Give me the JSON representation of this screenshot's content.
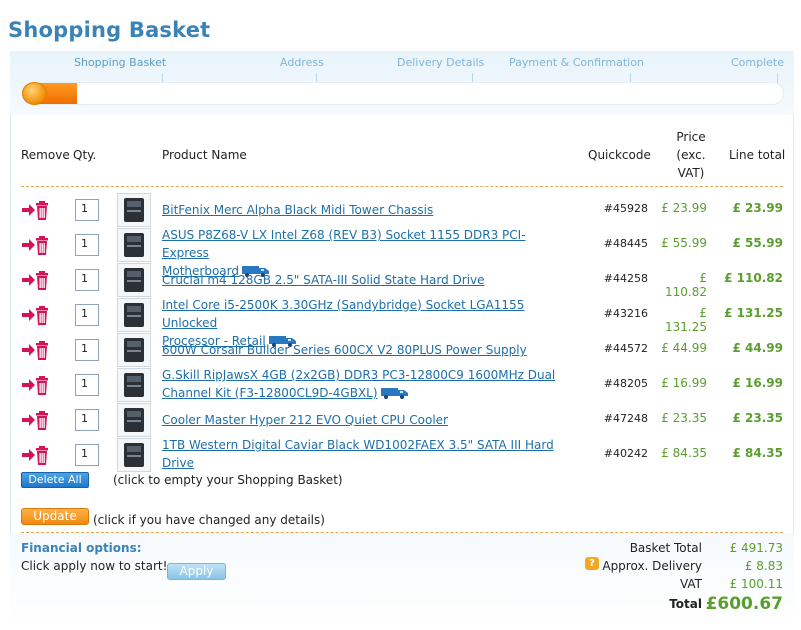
{
  "page": {
    "title": "Shopping Basket"
  },
  "steps": [
    {
      "label": "Shopping Basket"
    },
    {
      "label": "Address"
    },
    {
      "label": "Delivery Details"
    },
    {
      "label": "Payment & Confirmation"
    },
    {
      "label": "Complete"
    }
  ],
  "progress": {
    "current_step": 1,
    "total_steps": 5
  },
  "table": {
    "headers": {
      "remove": "Remove",
      "qty": "Qty.",
      "product": "Product Name",
      "quickcode": "Quickcode",
      "price_line1": "Price",
      "price_line2": "(exc.",
      "price_line3": "VAT)",
      "line_total": "Line total"
    },
    "rows": [
      {
        "qty": "1",
        "name": "BitFenix Merc Alpha Black Midi Tower Chassis",
        "name2": "",
        "truck": false,
        "quickcode": "#45928",
        "price": "£ 23.99",
        "total": "£ 23.99"
      },
      {
        "qty": "1",
        "name": "ASUS P8Z68-V LX Intel Z68 (REV B3) Socket 1155 DDR3 PCI-Express",
        "name2": "Motherboard",
        "truck": true,
        "quickcode": "#48445",
        "price": "£ 55.99",
        "total": "£ 55.99"
      },
      {
        "qty": "1",
        "name": "Crucial m4 128GB 2.5\" SATA-III Solid State Hard Drive",
        "name2": "",
        "truck": false,
        "quickcode": "#44258",
        "price": "£ 110.82",
        "total": "£ 110.82"
      },
      {
        "qty": "1",
        "name": "Intel Core i5-2500K 3.30GHz (Sandybridge) Socket LGA1155 Unlocked",
        "name2": "Processor - Retail",
        "truck": true,
        "quickcode": "#43216",
        "price": "£ 131.25",
        "total": "£ 131.25"
      },
      {
        "qty": "1",
        "name": "600W Corsair Builder Series 600CX V2 80PLUS Power Supply",
        "name2": "",
        "truck": false,
        "quickcode": "#44572",
        "price": "£ 44.99",
        "total": "£ 44.99"
      },
      {
        "qty": "1",
        "name": "G.Skill RipJawsX 4GB (2x2GB) DDR3 PC3-12800C9 1600MHz Dual",
        "name2": "Channel Kit (F3-12800CL9D-4GBXL)",
        "truck": true,
        "quickcode": "#48205",
        "price": "£ 16.99",
        "total": "£ 16.99"
      },
      {
        "qty": "1",
        "name": "Cooler Master Hyper 212 EVO Quiet CPU Cooler",
        "name2": "",
        "truck": false,
        "quickcode": "#47248",
        "price": "£ 23.35",
        "total": "£ 23.35"
      },
      {
        "qty": "1",
        "name": "1TB Western Digital Caviar Black WD1002FAEX 3.5\" SATA III Hard",
        "name2": "Drive",
        "truck": false,
        "quickcode": "#40242",
        "price": "£ 84.35",
        "total": "£ 84.35"
      }
    ]
  },
  "actions": {
    "delete_all": "Delete All",
    "delete_all_note": "(click to empty your Shopping Basket)",
    "update": "Update",
    "update_note": "(click if you have changed any details)"
  },
  "financial": {
    "title": "Financial options:",
    "text": "Click apply now to start!",
    "apply": "Apply"
  },
  "summary": {
    "basket_total_label": "Basket Total",
    "basket_total": "£ 491.73",
    "delivery_label": "Approx. Delivery",
    "delivery": "£ 8.83",
    "vat_label": "VAT",
    "vat": "£ 100.11",
    "total_label": "Total",
    "total": "£600.67"
  },
  "colors": {
    "accent_blue": "#3b83b6",
    "link_blue": "#1e6fa8",
    "price_green": "#5a9e2f",
    "progress_orange": "#f07a00",
    "remove_red": "#d4145a"
  }
}
